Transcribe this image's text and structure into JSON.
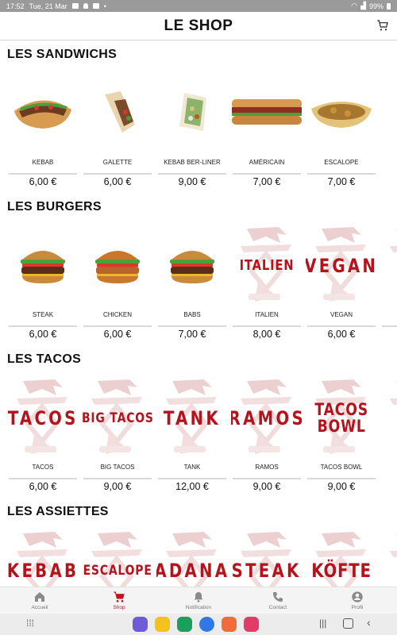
{
  "status": {
    "time": "17:52",
    "date": "Tue, 21 Mar",
    "battery": "99%"
  },
  "header": {
    "title": "LE SHOP"
  },
  "sections": [
    {
      "title": "LES SANDWICHS",
      "items": [
        {
          "name": "KEBAB",
          "price": "6,00 €",
          "image": "sandwich-kebab"
        },
        {
          "name": "GALETTE",
          "price": "6,00 €",
          "image": "sandwich-galette"
        },
        {
          "name": "KEBAB BER-LINER",
          "price": "9,00 €",
          "image": "sandwich-berliner"
        },
        {
          "name": "AMÉRICAIN",
          "price": "7,00 €",
          "image": "sandwich-americain"
        },
        {
          "name": "ESCALOPE",
          "price": "7,00 €",
          "image": "sandwich-escalope"
        }
      ]
    },
    {
      "title": "LES BURGERS",
      "items": [
        {
          "name": "STEAK",
          "price": "6,00 €",
          "image": "burger-steak"
        },
        {
          "name": "CHICKEN",
          "price": "6,00 €",
          "image": "burger-chicken"
        },
        {
          "name": "BABS",
          "price": "7,00 €",
          "image": "burger-babs"
        },
        {
          "name": "ITALIEN",
          "price": "8,00 €",
          "label": "ITALIEN"
        },
        {
          "name": "VEGAN",
          "price": "6,00 €",
          "label": "VEGAN"
        },
        {
          "name": "M",
          "price": "",
          "label": "MIN"
        }
      ]
    },
    {
      "title": "LES TACOS",
      "items": [
        {
          "name": "TACOS",
          "price": "6,00 €",
          "label": "TACOS"
        },
        {
          "name": "BIG TACOS",
          "price": "9,00 €",
          "label": "BIG TACOS"
        },
        {
          "name": "TANK",
          "price": "12,00 €",
          "label": "TANK"
        },
        {
          "name": "RAMOS",
          "price": "9,00 €",
          "label": "RAMOS"
        },
        {
          "name": "TACOS BOWL",
          "price": "9,00 €",
          "label": "TACOS BOWL"
        },
        {
          "name": "",
          "price": "",
          "label": "K"
        }
      ]
    },
    {
      "title": "LES ASSIETTES",
      "items": [
        {
          "name": "",
          "price": "",
          "label": "KEBAB"
        },
        {
          "name": "",
          "price": "",
          "label": "ESCALOPE"
        },
        {
          "name": "",
          "price": "",
          "label": "ADANA"
        },
        {
          "name": "",
          "price": "",
          "label": "STEAK"
        },
        {
          "name": "",
          "price": "",
          "label": "KÖFTE"
        },
        {
          "name": "",
          "price": "",
          "label": "OT"
        }
      ]
    }
  ],
  "nav": [
    {
      "label": "Accueil",
      "icon": "home-icon"
    },
    {
      "label": "Shop",
      "icon": "cart-icon"
    },
    {
      "label": "Notification",
      "icon": "bell-icon"
    },
    {
      "label": "Contact",
      "icon": "phone-icon"
    },
    {
      "label": "Profil",
      "icon": "user-icon"
    }
  ],
  "colors": {
    "brand_red": "#b5121b",
    "nav_active": "#c1141f"
  }
}
